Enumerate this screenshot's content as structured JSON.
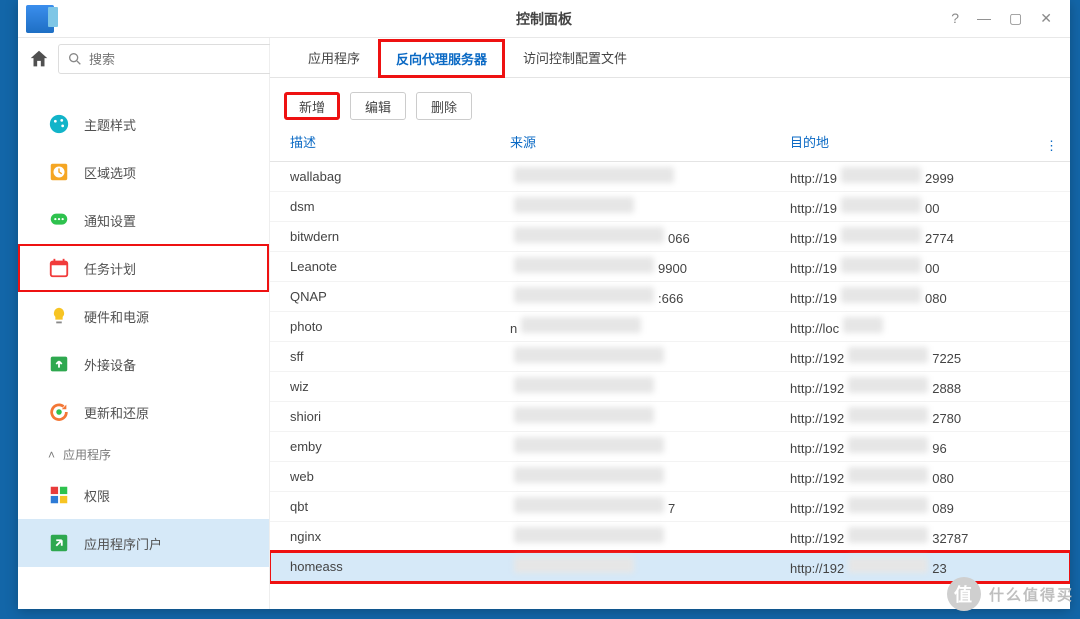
{
  "window": {
    "title": "控制面板"
  },
  "search": {
    "placeholder": "搜索"
  },
  "sidebar": {
    "items": [
      {
        "label": "主题样式",
        "name": "theme",
        "icon": "palette",
        "color": "#12b4c9"
      },
      {
        "label": "区域选项",
        "name": "locale",
        "icon": "clock",
        "color": "#f5a623"
      },
      {
        "label": "通知设置",
        "name": "notify",
        "icon": "chat",
        "color": "#2ec24e"
      },
      {
        "label": "任务计划",
        "name": "tasks",
        "icon": "calendar",
        "color": "#f13b3b",
        "highlight": true
      },
      {
        "label": "硬件和电源",
        "name": "power",
        "icon": "bulb",
        "color": "#f7c423"
      },
      {
        "label": "外接设备",
        "name": "external",
        "icon": "upload",
        "color": "#2ea84f"
      },
      {
        "label": "更新和还原",
        "name": "update",
        "icon": "refresh",
        "color": "#f37735"
      }
    ],
    "section_label": "应用程序",
    "items2": [
      {
        "label": "权限",
        "name": "perm",
        "icon": "grid",
        "color": "#2d7ad6"
      },
      {
        "label": "应用程序门户",
        "name": "portal",
        "icon": "portal",
        "color": "#2ea84f",
        "active": true
      }
    ]
  },
  "tabs": [
    {
      "label": "应用程序",
      "name": "apps"
    },
    {
      "label": "反向代理服务器",
      "name": "reverse-proxy",
      "active": true,
      "highlight": true
    },
    {
      "label": "访问控制配置文件",
      "name": "acl"
    }
  ],
  "toolbar": {
    "add": "新增",
    "edit": "编辑",
    "delete": "删除"
  },
  "grid": {
    "head": {
      "desc": "描述",
      "src": "来源",
      "dest": "目的地"
    },
    "rows": [
      {
        "desc": "wallabag",
        "dest_pre": "http://19",
        "dest_suf": "2999",
        "src_w": 160,
        "dest_w": 80
      },
      {
        "desc": "dsm",
        "dest_pre": "http://19",
        "dest_suf": "00",
        "src_w": 120,
        "dest_w": 80
      },
      {
        "desc": "bitwdern",
        "dest_pre": "http://19",
        "dest_suf": "2774",
        "src_w": 150,
        "dest_w": 80,
        "src_suf": "066"
      },
      {
        "desc": "Leanote",
        "dest_pre": "http://19",
        "dest_suf": "00",
        "src_w": 140,
        "dest_w": 80,
        "src_suf": "9900"
      },
      {
        "desc": "QNAP",
        "dest_pre": "http://19",
        "dest_suf": "080",
        "src_w": 140,
        "dest_w": 80,
        "src_suf": ":666"
      },
      {
        "desc": "photo",
        "dest_pre": "http://loc",
        "dest_suf": "",
        "src_w": 120,
        "dest_w": 40,
        "src_mid": "n"
      },
      {
        "desc": "sff",
        "dest_pre": "http://192",
        "dest_suf": "7225",
        "src_w": 150,
        "dest_w": 80
      },
      {
        "desc": "wiz",
        "dest_pre": "http://192",
        "dest_suf": "2888",
        "src_w": 140,
        "dest_w": 80
      },
      {
        "desc": "shiori",
        "dest_pre": "http://192",
        "dest_suf": "2780",
        "src_w": 140,
        "dest_w": 80
      },
      {
        "desc": "emby",
        "dest_pre": "http://192",
        "dest_suf": "96",
        "src_w": 150,
        "dest_w": 80
      },
      {
        "desc": "web",
        "dest_pre": "http://192",
        "dest_suf": "080",
        "src_w": 150,
        "dest_w": 80
      },
      {
        "desc": "qbt",
        "dest_pre": "http://192",
        "dest_suf": "089",
        "src_w": 150,
        "dest_w": 80,
        "src_suf": "7"
      },
      {
        "desc": "nginx",
        "dest_pre": "http://192",
        "dest_suf": "32787",
        "src_w": 150,
        "dest_w": 80
      },
      {
        "desc": "homeass",
        "dest_pre": "http://192",
        "dest_suf": "23",
        "src_w": 120,
        "dest_w": 80,
        "selected": true,
        "highlight": true
      }
    ]
  },
  "watermark": "什么值得买"
}
